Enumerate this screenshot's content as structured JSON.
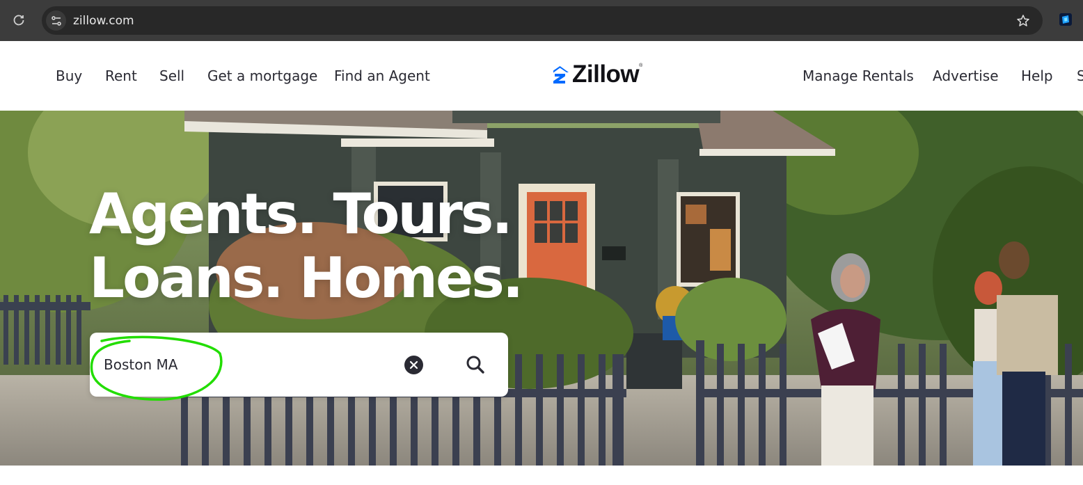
{
  "browser": {
    "url": "zillow.com",
    "reload_icon": "reload-icon",
    "site_info_icon": "site-settings-icon",
    "bookmark_icon": "star-icon",
    "extension_icon": "extension-icon"
  },
  "nav": {
    "left": [
      "Buy",
      "Rent",
      "Sell",
      "Get a mortgage",
      "Find an Agent"
    ],
    "right": [
      "Manage Rentals",
      "Advertise",
      "Help",
      "Sign In"
    ]
  },
  "logo": {
    "text": "Zillow",
    "reg": "®",
    "brand_color": "#006aff"
  },
  "hero": {
    "headline_line1": "Agents. Tours.",
    "headline_line2": "Loans. Homes.",
    "search_value": "Boston MA",
    "clear_icon": "clear-icon",
    "search_icon": "search-icon"
  },
  "colors": {
    "chrome_bg": "#3c3c3c",
    "address_bar_bg": "#282828",
    "text_dark": "#2a2a33",
    "annotation": "#22dd00"
  }
}
